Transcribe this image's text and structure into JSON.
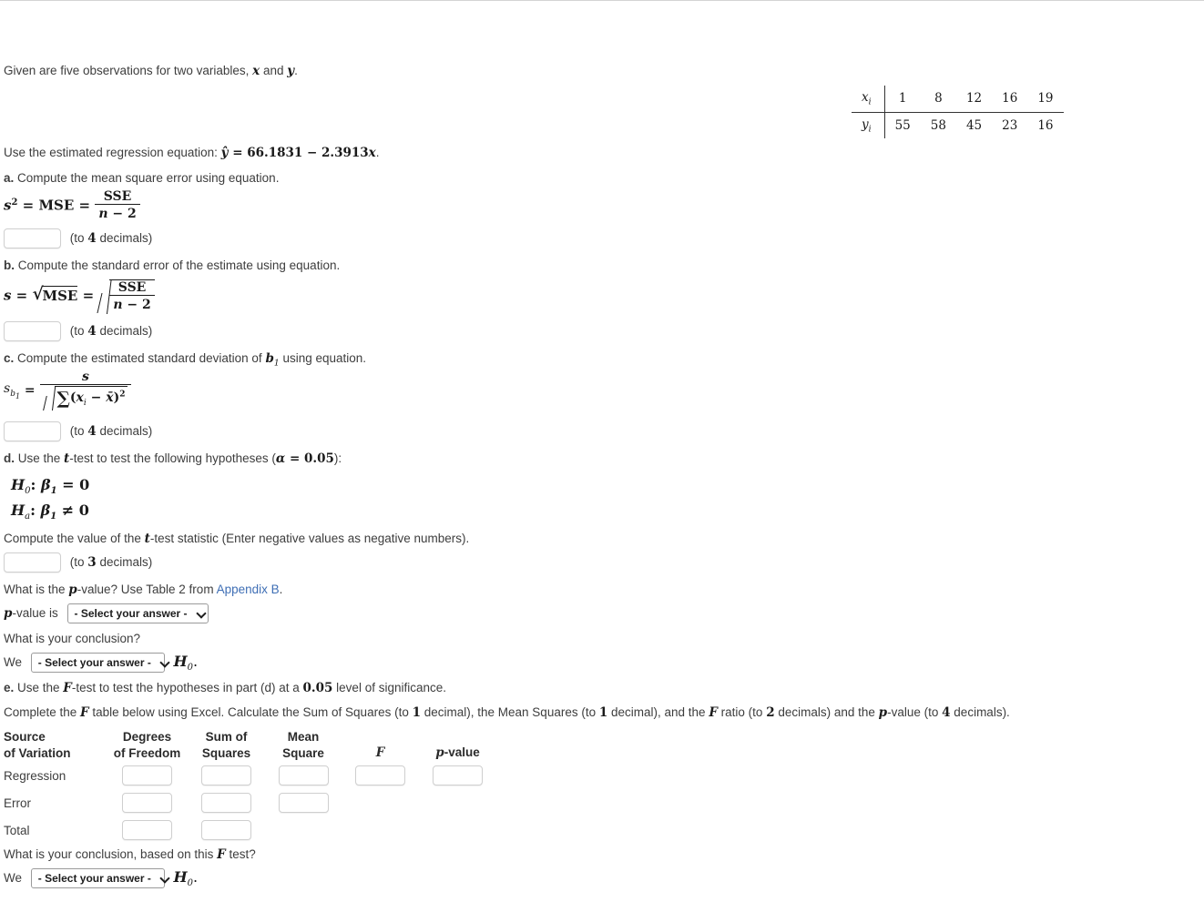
{
  "intro": {
    "line1_pre": "Given are five observations for two variables, ",
    "var_x": "x",
    "line1_mid": " and ",
    "var_y": "y",
    "line1_post": "."
  },
  "data_table": {
    "row_x_label": "x",
    "row_x_sub": "i",
    "row_y_label": "y",
    "row_y_sub": "i",
    "x_values": [
      "1",
      "8",
      "12",
      "16",
      "19"
    ],
    "y_values": [
      "55",
      "58",
      "45",
      "23",
      "16"
    ]
  },
  "regression": {
    "prefix": "Use the estimated regression equation: ",
    "yhat": "ŷ",
    "equals": " = ",
    "intercept": "66.1831",
    "minus": " − ",
    "slope": "2.3913",
    "xvar": "x",
    "period": "."
  },
  "part_a": {
    "letter": "a.",
    "text": " Compute the mean square error using equation.",
    "formula": {
      "lhs_s": "s",
      "lhs_sup": "2",
      "eq1": " = ",
      "mse": "MSE",
      "eq2": " = ",
      "numerator": "SSE",
      "denominator_n": "n",
      "denominator_rest": " − 2"
    },
    "hint_pre": "(to ",
    "hint_num": "4",
    "hint_post": " decimals)",
    "input_value": ""
  },
  "part_b": {
    "letter": "b.",
    "text": " Compute the standard error of the estimate using equation.",
    "formula": {
      "lhs_s": "s",
      "eq1": " = ",
      "sqrt_mse": "MSE",
      "eq2": " = ",
      "numerator": "SSE",
      "denominator_n": "n",
      "denominator_rest": " − 2"
    },
    "hint_pre": "(to ",
    "hint_num": "4",
    "hint_post": " decimals)",
    "input_value": ""
  },
  "part_c": {
    "letter": "c.",
    "text_pre": " Compute the estimated standard deviation of ",
    "b_sym": "b",
    "b_sub": "1",
    "text_post": " using equation.",
    "formula": {
      "lhs_s": "s",
      "lhs_sub_b": "b",
      "lhs_sub_1": "1",
      "eq": " = ",
      "numerator": "s",
      "sigma": "∑",
      "den_open": "(",
      "den_x": "x",
      "den_x_sub": "i",
      "den_minus": " − ",
      "den_xbar": "x̄",
      "den_close": ")",
      "den_sup": "2"
    },
    "hint_pre": "(to ",
    "hint_num": "4",
    "hint_post": " decimals)",
    "input_value": ""
  },
  "part_d": {
    "letter": "d.",
    "text_pre": " Use the ",
    "t_sym": "t",
    "text_mid": "-test to test the following hypotheses (",
    "alpha": "α",
    "alpha_eq": " = ",
    "alpha_val": "0.05",
    "text_post": "):",
    "h0_label": "H",
    "h0_sub": "0",
    "h0_colon": ": ",
    "h0_beta": "β",
    "h0_beta_sub": "1",
    "h0_rel": " = 0",
    "ha_label": "H",
    "ha_sub": "a",
    "ha_colon": ": ",
    "ha_beta": "β",
    "ha_beta_sub": "1",
    "ha_rel": " ≠ 0",
    "compute_pre": "Compute the value of the ",
    "compute_t": "t",
    "compute_post": "-test statistic (Enter negative values as negative numbers).",
    "hint_pre": "(to ",
    "hint_num": "3",
    "hint_post": " decimals)",
    "input_value": ""
  },
  "pvalue_section": {
    "question_pre": "What is the ",
    "question_p": "p",
    "question_mid": "-value? Use Table 2 from ",
    "link_text": "Appendix B",
    "question_post": ".",
    "label_p": "p",
    "label_rest": "-value is",
    "dropdown_label": "- Select your answer -",
    "conclusion_question": "What is your conclusion?",
    "we_label": "We",
    "conclusion_dropdown_label": "- Select your answer -",
    "h0_label": "H",
    "h0_sub": "0",
    "h0_period": "."
  },
  "part_e": {
    "letter": "e.",
    "text_pre": " Use the ",
    "f_sym": "F",
    "text_mid": "-test to test the hypotheses in part (d) at a ",
    "level": "0.05",
    "text_post": " level of significance.",
    "instr_pre": "Complete the ",
    "instr_f": "F",
    "instr_mid1": " table below using Excel. Calculate the Sum of Squares (to ",
    "instr_n1": "1",
    "instr_mid2": " decimal), the Mean Squares (to ",
    "instr_n2": "1",
    "instr_mid3": " decimal), and the ",
    "instr_f2": "F",
    "instr_mid4": " ratio (to ",
    "instr_n3": "2",
    "instr_mid5": " decimals) and the ",
    "instr_p": "p",
    "instr_mid6": "-value (to ",
    "instr_n4": "4",
    "instr_end": " decimals)."
  },
  "anova_table": {
    "headers": [
      {
        "line1": "Source",
        "line2": "of Variation"
      },
      {
        "line1": "Degrees",
        "line2": "of Freedom"
      },
      {
        "line1": "Sum of",
        "line2": "Squares"
      },
      {
        "line1": "Mean",
        "line2": "Square"
      },
      {
        "line1": "",
        "line2": "F"
      },
      {
        "line1": "",
        "line2": "p-value"
      }
    ],
    "rows": [
      {
        "label": "Regression",
        "inputs": 5,
        "values": [
          "",
          "",
          "",
          "",
          ""
        ]
      },
      {
        "label": "Error",
        "inputs": 3,
        "values": [
          "",
          "",
          ""
        ]
      },
      {
        "label": "Total",
        "inputs": 2,
        "values": [
          "",
          ""
        ]
      }
    ]
  },
  "final_conclusion": {
    "question_pre": "What is your conclusion, based on this ",
    "question_f": "F",
    "question_post": " test?",
    "we_label": "We",
    "dropdown_label": "- Select your answer -",
    "h0_label": "H",
    "h0_sub": "0",
    "h0_period": "."
  },
  "colors": {
    "text": "#3d3d3d",
    "math": "#1a1a1a",
    "link": "#3f6fb5",
    "input_border": "#cfcfcf",
    "select_border": "#9a9a9a"
  }
}
